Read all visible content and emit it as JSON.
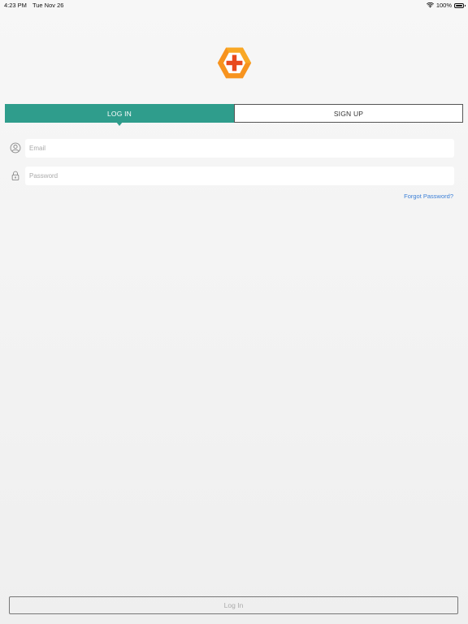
{
  "status_bar": {
    "time": "4:23 PM",
    "date": "Tue Nov 26",
    "battery": "100%"
  },
  "icons": {
    "wifi": "wifi-icon",
    "battery": "battery-icon",
    "logo": "hexagon-plus-logo",
    "email": "user-circle-icon",
    "password": "lock-icon"
  },
  "tabs": [
    {
      "label": "LOG IN",
      "active": true
    },
    {
      "label": "SIGN UP",
      "active": false
    }
  ],
  "form": {
    "email_placeholder": "Email",
    "email_value": "",
    "password_placeholder": "Password",
    "password_value": "",
    "forgot_label": "Forgot Password?"
  },
  "footer": {
    "login_label": "Log In"
  },
  "colors": {
    "accent": "#2f9d8c",
    "link": "#3b7fd6",
    "logo_orange": "#f7931e",
    "logo_red": "#e8491d"
  }
}
